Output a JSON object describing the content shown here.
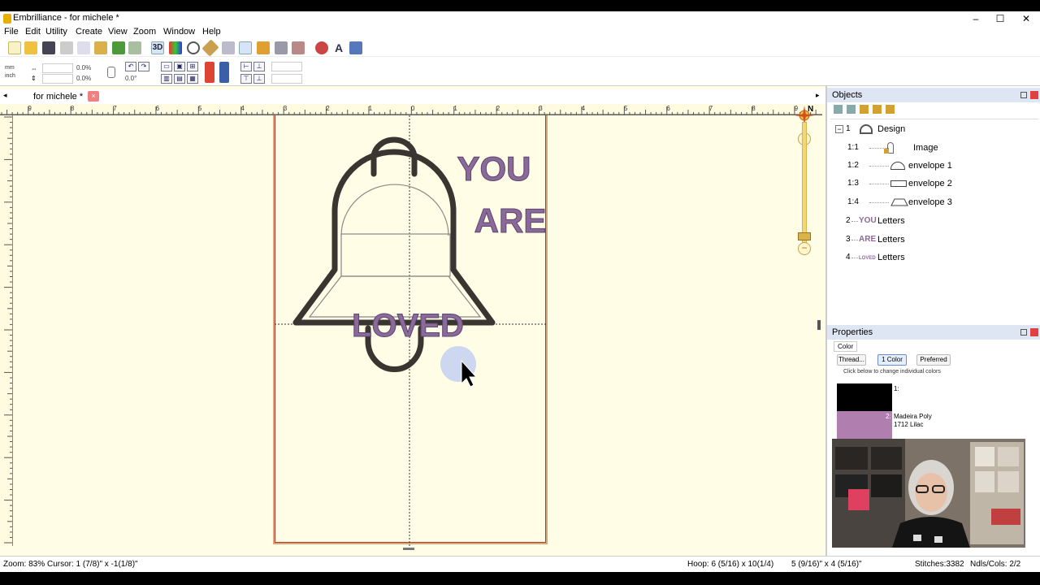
{
  "window": {
    "title": "Embrilliance - for michele *",
    "minimize": "–",
    "maximize": "☐",
    "close": "✕"
  },
  "menu": [
    "File",
    "Edit",
    "Utility",
    "Create",
    "View",
    "Zoom",
    "Window",
    "Help"
  ],
  "toolbar2": {
    "unit_mm": "mm",
    "unit_inch": "inch",
    "width_pct": "0.0%",
    "height_pct": "0.0%",
    "rotation": "0.0°"
  },
  "document": {
    "tab_title": "for michele *",
    "tab_close": "×",
    "ruler_marks": [
      "9",
      "8",
      "7",
      "6",
      "5",
      "4",
      "3",
      "2",
      "1",
      "0",
      "1",
      "2",
      "3",
      "4",
      "5",
      "6",
      "7",
      "8",
      "9"
    ],
    "compass": "N"
  },
  "design": {
    "text_you": "YOU",
    "text_are": "ARE",
    "text_loved": "LOVED",
    "text_color": "#8b6a9a",
    "outline_color": "#3a3530"
  },
  "objects_panel": {
    "title": "Objects",
    "items": [
      {
        "num": "1",
        "label": "Design",
        "icon": "design-icon"
      },
      {
        "num": "1:1",
        "label": "Image",
        "icon": "image-icon"
      },
      {
        "num": "1:2",
        "label": "envelope 1",
        "icon": "envelope-arc-icon"
      },
      {
        "num": "1:3",
        "label": "envelope 2",
        "icon": "envelope-rect-icon"
      },
      {
        "num": "1:4",
        "label": "envelope 3",
        "icon": "envelope-trap-icon"
      },
      {
        "num": "2",
        "prefix": "YOU",
        "label": "Letters"
      },
      {
        "num": "3",
        "prefix": "ARE",
        "label": "Letters"
      },
      {
        "num": "4",
        "prefix": "LOVED",
        "label": "Letters"
      }
    ]
  },
  "properties_panel": {
    "title": "Properties",
    "tab": "Color",
    "buttons": [
      "Thread...",
      "1 Color",
      "Preferred"
    ],
    "hint": "Click below to change individual colors",
    "colors": [
      {
        "index": "1:",
        "swatch": "#000000",
        "name": ""
      },
      {
        "index": "2:",
        "swatch": "#b07fb0",
        "name": "Madeira Poly",
        "code": "1712 Lilac"
      }
    ]
  },
  "status": {
    "zoom": "Zoom: 83%",
    "cursor": "Cursor: 1 (7/8)\" x -1(1/8)\"",
    "hoop": "Hoop: 6 (5/16) x 10(1/4)",
    "size": "5 (9/16)\" x 4 (5/16)\"",
    "stitches": "Stitches:3382",
    "ndls": "Ndls/Cols: 2/2"
  }
}
